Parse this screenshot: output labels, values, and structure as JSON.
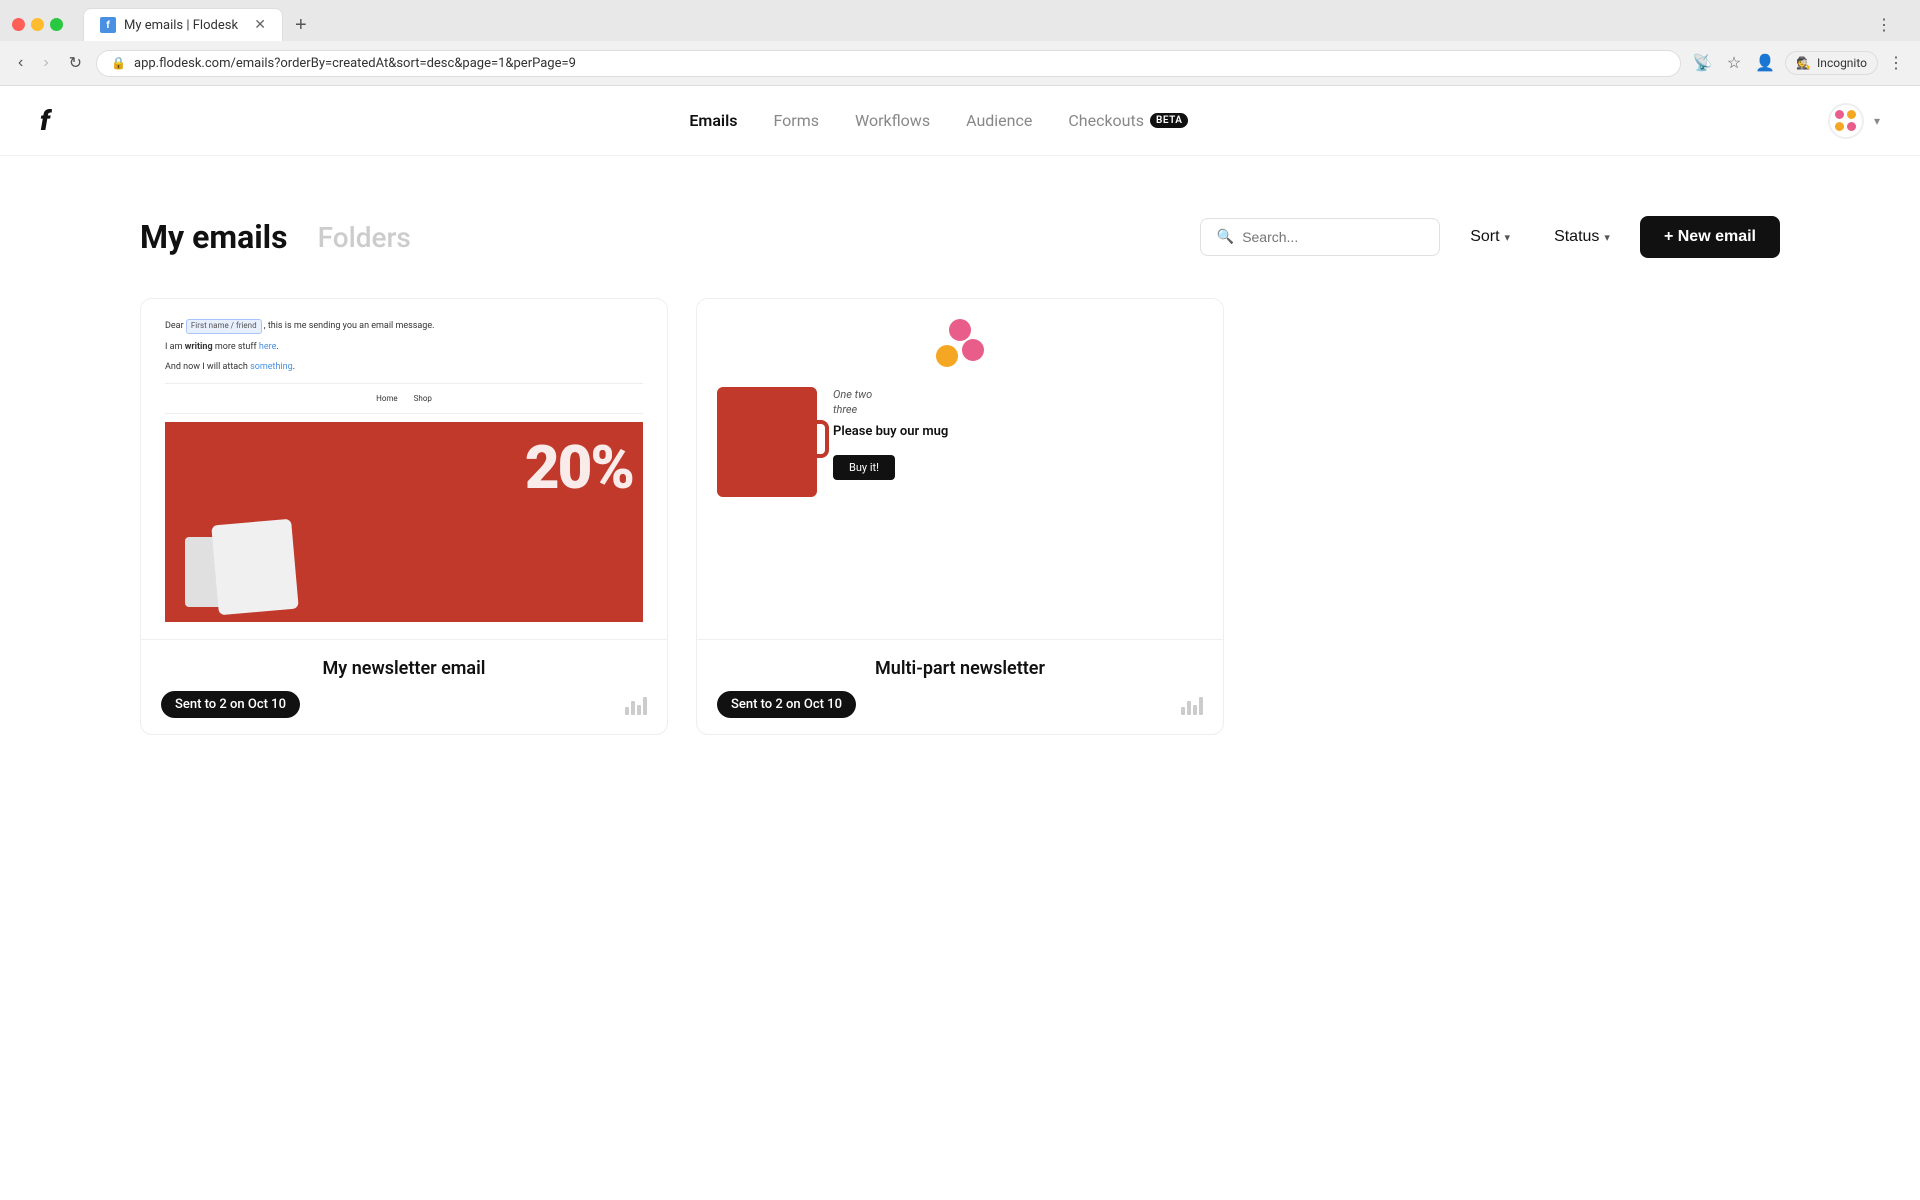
{
  "browser": {
    "tab_title": "My emails | Flodesk",
    "tab_favicon": "f",
    "url": "app.flodesk.com/emails?orderBy=createdAt&sort=desc&page=1&perPage=9",
    "new_tab_label": "+",
    "incognito_label": "Incognito"
  },
  "header": {
    "logo": "f",
    "nav": {
      "emails": "Emails",
      "forms": "Forms",
      "workflows": "Workflows",
      "audience": "Audience",
      "checkouts": "Checkouts",
      "beta_label": "BETA"
    }
  },
  "page": {
    "title": "My emails",
    "folders_label": "Folders",
    "search_placeholder": "Search...",
    "sort_label": "Sort",
    "status_label": "Status",
    "new_email_label": "+ New email"
  },
  "emails": [
    {
      "id": "email-1",
      "title": "My newsletter email",
      "sent_badge": "Sent to 2 on Oct 10",
      "preview_type": "newsletter",
      "preview_lines": [
        "Dear  First name / friend  , this is me sending you an email message.",
        "I am writing more stuff here.",
        "And now I will attach something."
      ],
      "preview_nav": [
        "Home",
        "Shop"
      ]
    },
    {
      "id": "email-2",
      "title": "Multi-part newsletter",
      "sent_badge": "Sent to 2 on Oct 10",
      "preview_type": "mug",
      "handwriting_lines": [
        "One two",
        "three"
      ],
      "mug_text": "Please buy our mug",
      "buy_btn": "Buy it!"
    }
  ]
}
